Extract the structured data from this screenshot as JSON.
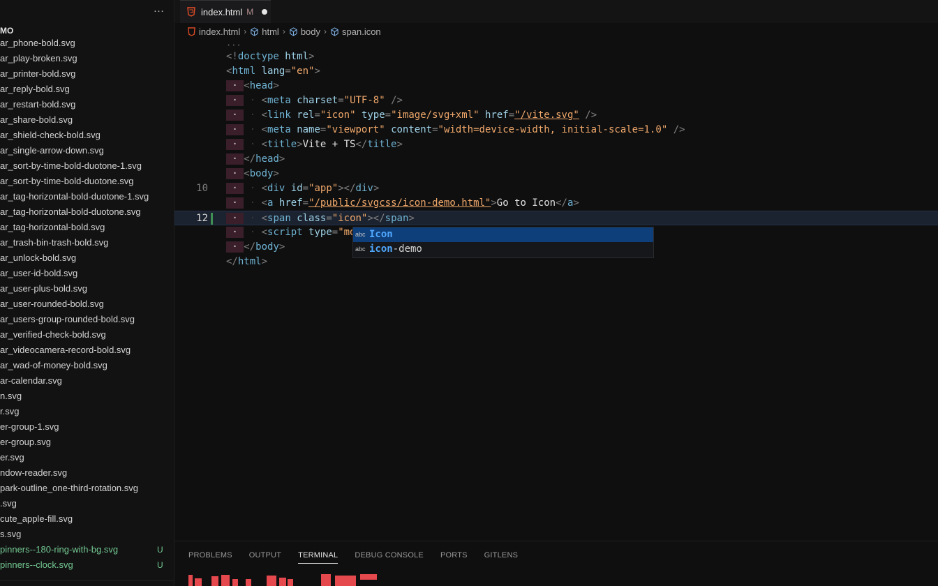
{
  "sidebar": {
    "more_icon": "…",
    "folder_label": "MO",
    "files": [
      {
        "name": "ar_phone-bold.svg",
        "status": ""
      },
      {
        "name": "ar_play-broken.svg",
        "status": ""
      },
      {
        "name": "ar_printer-bold.svg",
        "status": ""
      },
      {
        "name": "ar_reply-bold.svg",
        "status": ""
      },
      {
        "name": "ar_restart-bold.svg",
        "status": ""
      },
      {
        "name": "ar_share-bold.svg",
        "status": ""
      },
      {
        "name": "ar_shield-check-bold.svg",
        "status": ""
      },
      {
        "name": "ar_single-arrow-down.svg",
        "status": ""
      },
      {
        "name": "ar_sort-by-time-bold-duotone-1.svg",
        "status": ""
      },
      {
        "name": "ar_sort-by-time-bold-duotone.svg",
        "status": ""
      },
      {
        "name": "ar_tag-horizontal-bold-duotone-1.svg",
        "status": ""
      },
      {
        "name": "ar_tag-horizontal-bold-duotone.svg",
        "status": ""
      },
      {
        "name": "ar_tag-horizontal-bold.svg",
        "status": ""
      },
      {
        "name": "ar_trash-bin-trash-bold.svg",
        "status": ""
      },
      {
        "name": "ar_unlock-bold.svg",
        "status": ""
      },
      {
        "name": "ar_user-id-bold.svg",
        "status": ""
      },
      {
        "name": "ar_user-plus-bold.svg",
        "status": ""
      },
      {
        "name": "ar_user-rounded-bold.svg",
        "status": ""
      },
      {
        "name": "ar_users-group-rounded-bold.svg",
        "status": ""
      },
      {
        "name": "ar_verified-check-bold.svg",
        "status": ""
      },
      {
        "name": "ar_videocamera-record-bold.svg",
        "status": ""
      },
      {
        "name": "ar_wad-of-money-bold.svg",
        "status": ""
      },
      {
        "name": "ar-calendar.svg",
        "status": ""
      },
      {
        "name": "n.svg",
        "status": ""
      },
      {
        "name": "r.svg",
        "status": ""
      },
      {
        "name": "er-group-1.svg",
        "status": ""
      },
      {
        "name": "er-group.svg",
        "status": ""
      },
      {
        "name": "er.svg",
        "status": ""
      },
      {
        "name": "ndow-reader.svg",
        "status": ""
      },
      {
        "name": "park-outline_one-third-rotation.svg",
        "status": ""
      },
      {
        "name": ".svg",
        "status": ""
      },
      {
        "name": "cute_apple-fill.svg",
        "status": ""
      },
      {
        "name": "s.svg",
        "status": ""
      },
      {
        "name": "pinners--180-ring-with-bg.svg",
        "status": "U"
      },
      {
        "name": "pinners--clock.svg",
        "status": "U"
      }
    ]
  },
  "editor": {
    "tab": {
      "title": "index.html",
      "modified": "M"
    },
    "breadcrumb": [
      "index.html",
      "html",
      "body",
      "span.icon"
    ],
    "fold_marker": "···",
    "line_numbers": {
      "10": "10",
      "12": "12"
    },
    "autocomplete": [
      {
        "kind": "abc",
        "match": "Icon",
        "rest": ""
      },
      {
        "kind": "abc",
        "match": "icon",
        "rest": "-demo"
      }
    ],
    "code": {
      "l1_a": "<!",
      "l1_b": "doctype",
      "l1_c": " html",
      "l1_d": ">",
      "l2_attr": "lang",
      "l2_val": "\"en\"",
      "l4_val": "\"UTF-8\"",
      "l5_rel": "\"icon\"",
      "l5_type": "\"image/svg+xml\"",
      "l5_href": "\"/vite.svg\"",
      "l6_name": "\"viewport\"",
      "l6_content": "\"width=device-width, initial-scale=1.0\"",
      "l7_text": "Vite + TS",
      "l10_id": "\"app\"",
      "l11_href": "\"/public/svgcss/icon-demo.html\"",
      "l11_text": "Go to Icon",
      "l12_class": "\"icon\"",
      "l13_type": "\"mod"
    }
  },
  "panel": {
    "tabs": [
      "PROBLEMS",
      "OUTPUT",
      "TERMINAL",
      "DEBUG CONSOLE",
      "PORTS",
      "GITLENS"
    ],
    "active": "TERMINAL"
  },
  "colors": {
    "accent": "#0f3f7a",
    "untracked": "#73c991",
    "error_red": "#e5484d"
  }
}
